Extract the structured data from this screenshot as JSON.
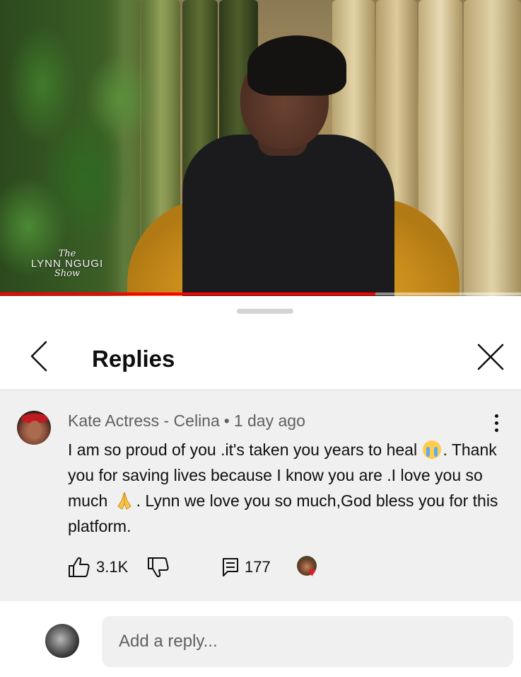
{
  "video": {
    "watermark": {
      "line1": "The",
      "line2": "LYNN NGUGI",
      "line3": "Show"
    },
    "progress": 0.72
  },
  "sheet": {
    "title": "Replies",
    "back_icon": "chevron-left-icon",
    "close_icon": "close-icon"
  },
  "comment": {
    "author": "Kate Actress - Celina",
    "separator": "•",
    "time": "1 day ago",
    "text_part1": "I am so proud of you .it's taken you years to heal ",
    "emoji1": "loudly-crying-face",
    "text_part2": ". Thank you for saving lives because I know you are .I love you so much ",
    "emoji2": "folded-hands",
    "text_part3": ". Lynn we love you so much,God bless you for this platform.",
    "likes": "3.1K",
    "replies": "177",
    "creator_heart": true
  },
  "reply_box": {
    "placeholder": "Add a reply..."
  },
  "colors": {
    "progress": "#ff0000",
    "heart": "#e41b23",
    "panel_bg": "#f0f0f0"
  }
}
